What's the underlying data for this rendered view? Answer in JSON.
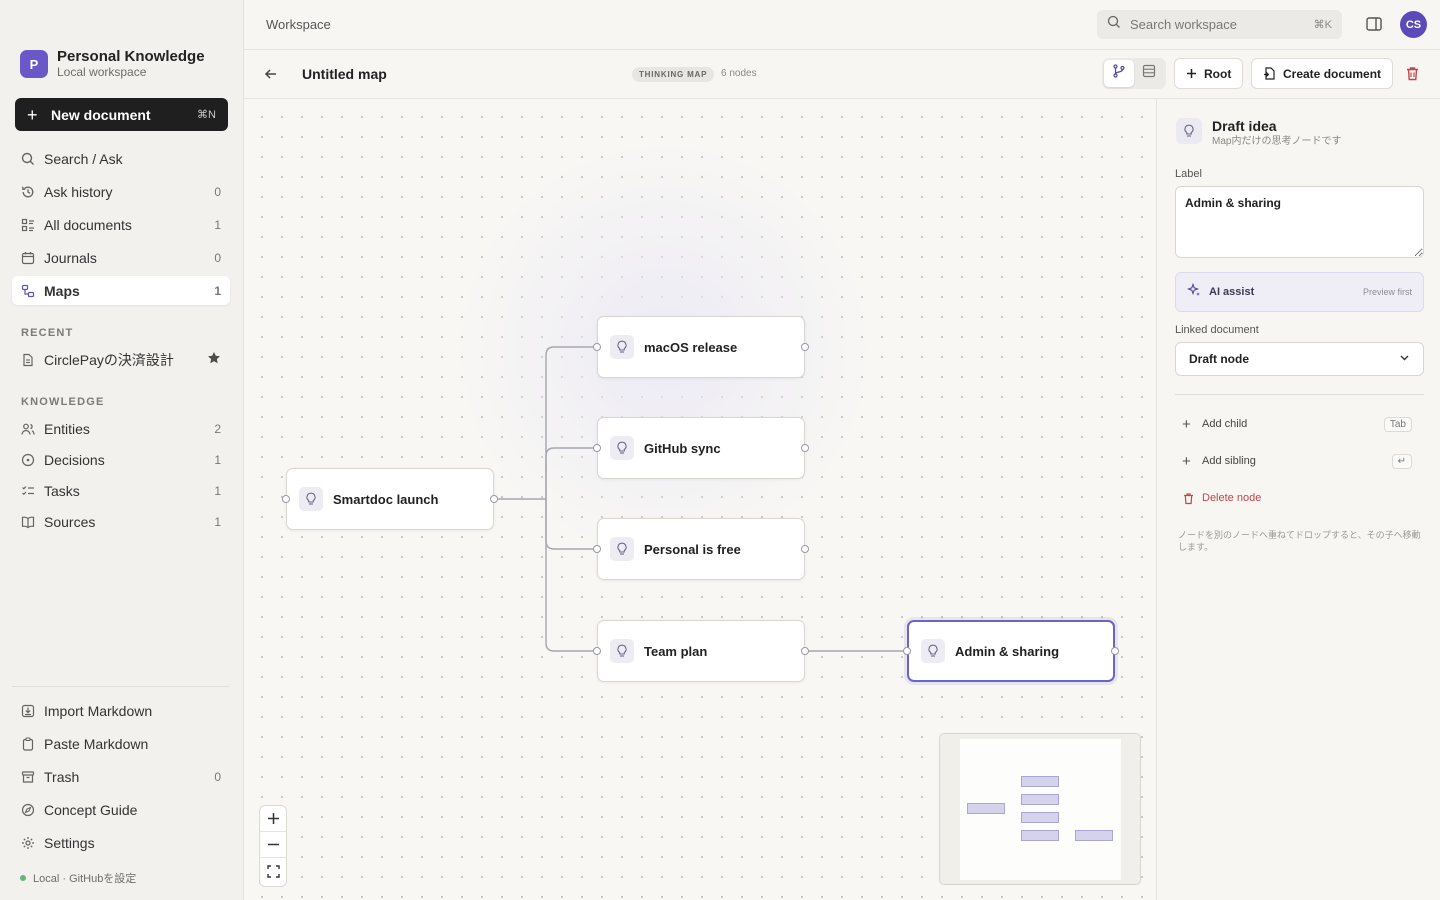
{
  "workspace": {
    "avatar_letter": "P",
    "title": "Personal Knowledge",
    "subtitle": "Local workspace"
  },
  "new_document": {
    "label": "New document",
    "shortcut": "⌘N"
  },
  "nav": [
    {
      "label": "Search / Ask",
      "count": "",
      "icon": "search-icon"
    },
    {
      "label": "Ask history",
      "count": "0",
      "icon": "history-icon"
    },
    {
      "label": "All documents",
      "count": "1",
      "icon": "documents-icon"
    },
    {
      "label": "Journals",
      "count": "0",
      "icon": "calendar-icon"
    },
    {
      "label": "Maps",
      "count": "1",
      "icon": "map-icon",
      "active": true
    }
  ],
  "recent": {
    "heading": "RECENT",
    "items": [
      {
        "label": "CirclePayの決済設計",
        "starred": true
      }
    ]
  },
  "knowledge": {
    "heading": "KNOWLEDGE",
    "items": [
      {
        "label": "Entities",
        "count": "2",
        "icon": "people-icon"
      },
      {
        "label": "Decisions",
        "count": "1",
        "icon": "target-icon"
      },
      {
        "label": "Tasks",
        "count": "1",
        "icon": "checklist-icon"
      },
      {
        "label": "Sources",
        "count": "1",
        "icon": "book-icon"
      }
    ]
  },
  "bottom_nav": [
    {
      "label": "Import Markdown",
      "count": "",
      "icon": "import-icon"
    },
    {
      "label": "Paste Markdown",
      "count": "",
      "icon": "clipboard-icon"
    },
    {
      "label": "Trash",
      "count": "0",
      "icon": "trash-icon"
    },
    {
      "label": "Concept Guide",
      "count": "",
      "icon": "compass-icon"
    },
    {
      "label": "Settings",
      "count": "",
      "icon": "gear-icon"
    }
  ],
  "status": {
    "text": "Local · GitHubを設定",
    "color": "#6bb17a"
  },
  "topbar": {
    "breadcrumb": "Workspace",
    "search_placeholder": "Search workspace",
    "search_shortcut": "⌘K",
    "user_initials": "CS"
  },
  "map": {
    "title": "Untitled map",
    "badge": "THINKING MAP",
    "node_count": "6 nodes",
    "root_label": "Root",
    "create_label": "Create document"
  },
  "nodes": [
    {
      "label": "Smartdoc launch"
    },
    {
      "label": "macOS release"
    },
    {
      "label": "GitHub sync"
    },
    {
      "label": "Personal is free"
    },
    {
      "label": "Team plan"
    },
    {
      "label": "Admin & sharing",
      "selected": true
    }
  ],
  "inspector": {
    "title": "Draft idea",
    "subtitle": "Map内だけの思考ノードです",
    "label_caption": "Label",
    "label_value": "Admin & sharing",
    "ai_label": "AI assist",
    "ai_hint": "Preview first",
    "linked_caption": "Linked document",
    "linked_value": "Draft node",
    "add_child": "Add child",
    "add_child_key": "Tab",
    "add_sibling": "Add sibling",
    "add_sibling_key": "↵",
    "delete_node": "Delete node",
    "help": "ノードを別のノードへ重ねてドロップすると、その子へ移動します。"
  },
  "colors": {
    "accent": "#6c64c6",
    "brand": "#6a58c9",
    "danger": "#c2474d"
  }
}
